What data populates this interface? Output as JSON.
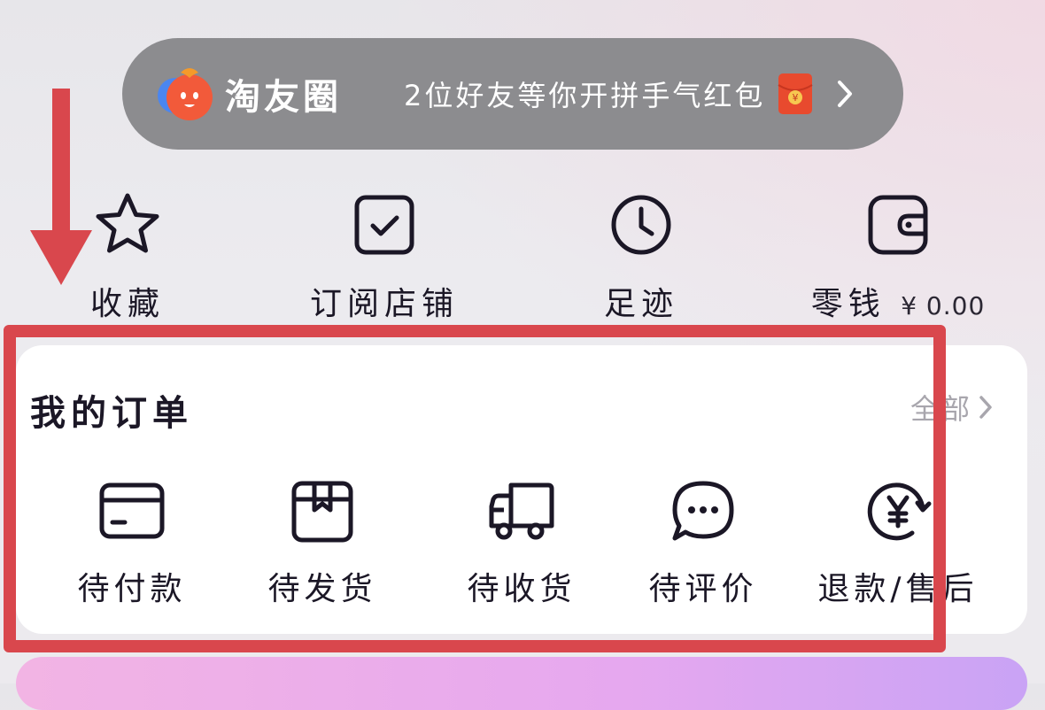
{
  "banner": {
    "brand": "淘友圈",
    "message": "2位好友等你开拼手气红包",
    "logo_icon": "taoyouquan-logo-icon",
    "envelope_icon": "red-envelope-icon",
    "chevron_icon": "chevron-right-icon"
  },
  "quick_actions": [
    {
      "label": "收藏",
      "icon": "star-icon"
    },
    {
      "label": "订阅店铺",
      "icon": "check-square-icon"
    },
    {
      "label": "足迹",
      "icon": "clock-icon"
    },
    {
      "label": "零钱",
      "amount": "¥ 0.00",
      "icon": "wallet-icon"
    }
  ],
  "orders": {
    "title": "我的订单",
    "all_label": "全部",
    "items": [
      {
        "label": "待付款",
        "icon": "card-icon"
      },
      {
        "label": "待发货",
        "icon": "package-icon"
      },
      {
        "label": "待收货",
        "icon": "truck-icon"
      },
      {
        "label": "待评价",
        "icon": "chat-bubble-icon"
      },
      {
        "label": "退款/售后",
        "icon": "refund-yen-icon"
      }
    ]
  },
  "colors": {
    "highlight": "#d9474d",
    "pill_bg": "#8c8c8f",
    "text": "#1b1726",
    "muted": "#a8a6ad"
  }
}
